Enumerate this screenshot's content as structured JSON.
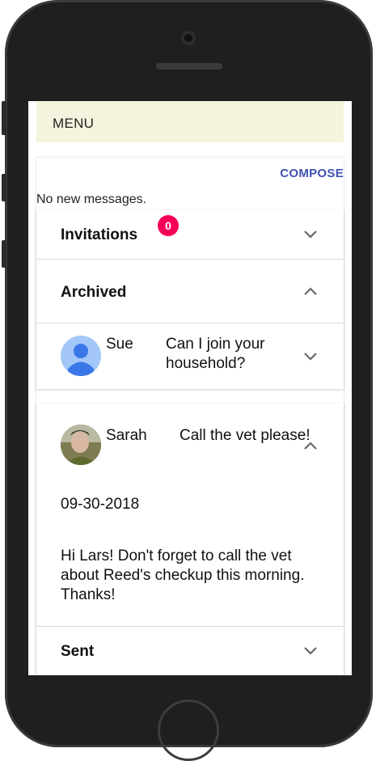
{
  "menu": {
    "label": "MENU"
  },
  "messages": {
    "compose_label": "COMPOSE",
    "empty_text": "No new messages.",
    "invitations": {
      "title": "Invitations",
      "count": "0"
    },
    "archived": {
      "title": "Archived",
      "items": [
        {
          "sender": "Sue",
          "subject": "Can I join your household?"
        },
        {
          "sender": "Sarah",
          "subject": "Call the vet please!",
          "date": "09-30-2018",
          "body": "Hi Lars! Don't forget to call the vet about Reed's checkup this morning. Thanks!"
        }
      ]
    },
    "sent": {
      "title": "Sent"
    }
  },
  "colors": {
    "accent": "#3f51b5",
    "badge": "#f50057",
    "menu_bg": "#f4f3dd",
    "avatar_blue": "#a3c7f8"
  }
}
